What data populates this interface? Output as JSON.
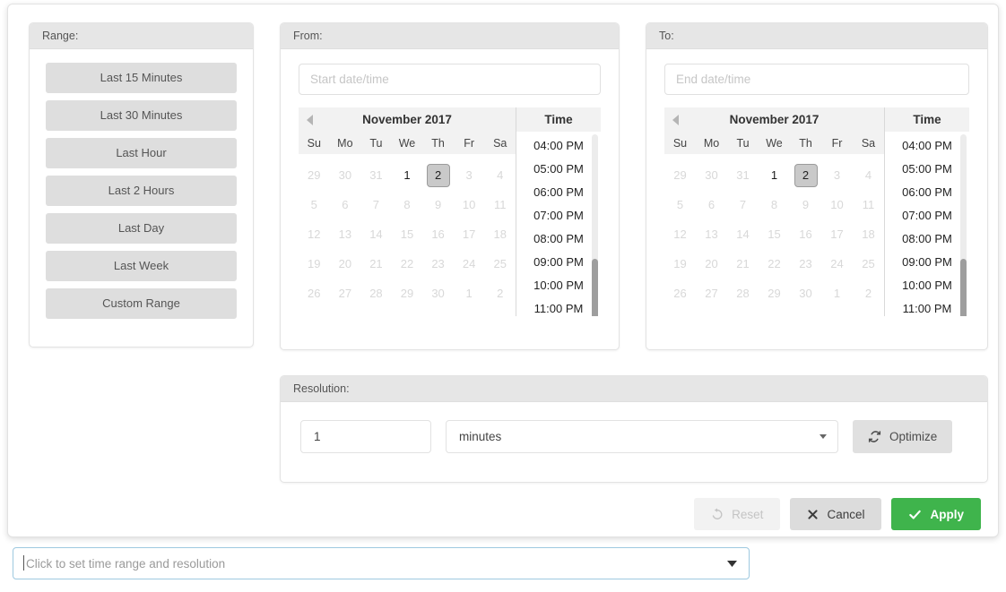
{
  "popover": {
    "range": {
      "header": "Range:",
      "buttons": [
        "Last 15 Minutes",
        "Last 30 Minutes",
        "Last Hour",
        "Last 2 Hours",
        "Last Day",
        "Last Week",
        "Custom Range"
      ]
    },
    "from": {
      "header": "From:",
      "input_value": "",
      "input_placeholder": "Start date/time",
      "calendar": {
        "prev_icon": "chevron-left-icon",
        "month_title": "November 2017",
        "weekdays": [
          "Su",
          "Mo",
          "Tu",
          "We",
          "Th",
          "Fr",
          "Sa"
        ],
        "weeks": [
          [
            {
              "d": "29",
              "state": "disabled"
            },
            {
              "d": "30",
              "state": "disabled"
            },
            {
              "d": "31",
              "state": "disabled"
            },
            {
              "d": "1",
              "state": "enabled"
            },
            {
              "d": "2",
              "state": "selected"
            },
            {
              "d": "3",
              "state": "disabled"
            },
            {
              "d": "4",
              "state": "disabled"
            }
          ],
          [
            {
              "d": "5",
              "state": "disabled"
            },
            {
              "d": "6",
              "state": "disabled"
            },
            {
              "d": "7",
              "state": "disabled"
            },
            {
              "d": "8",
              "state": "disabled"
            },
            {
              "d": "9",
              "state": "disabled"
            },
            {
              "d": "10",
              "state": "disabled"
            },
            {
              "d": "11",
              "state": "disabled"
            }
          ],
          [
            {
              "d": "12",
              "state": "disabled"
            },
            {
              "d": "13",
              "state": "disabled"
            },
            {
              "d": "14",
              "state": "disabled"
            },
            {
              "d": "15",
              "state": "disabled"
            },
            {
              "d": "16",
              "state": "disabled"
            },
            {
              "d": "17",
              "state": "disabled"
            },
            {
              "d": "18",
              "state": "disabled"
            }
          ],
          [
            {
              "d": "19",
              "state": "disabled"
            },
            {
              "d": "20",
              "state": "disabled"
            },
            {
              "d": "21",
              "state": "disabled"
            },
            {
              "d": "22",
              "state": "disabled"
            },
            {
              "d": "23",
              "state": "disabled"
            },
            {
              "d": "24",
              "state": "disabled"
            },
            {
              "d": "25",
              "state": "disabled"
            }
          ],
          [
            {
              "d": "26",
              "state": "disabled"
            },
            {
              "d": "27",
              "state": "disabled"
            },
            {
              "d": "28",
              "state": "disabled"
            },
            {
              "d": "29",
              "state": "disabled"
            },
            {
              "d": "30",
              "state": "disabled"
            },
            {
              "d": "1",
              "state": "disabled"
            },
            {
              "d": "2",
              "state": "disabled"
            }
          ]
        ]
      },
      "time": {
        "header": "Time",
        "items": [
          "04:00 PM",
          "05:00 PM",
          "06:00 PM",
          "07:00 PM",
          "08:00 PM",
          "09:00 PM",
          "10:00 PM",
          "11:00 PM"
        ]
      }
    },
    "to": {
      "header": "To:",
      "input_value": "",
      "input_placeholder": "End date/time",
      "calendar": {
        "prev_icon": "chevron-left-icon",
        "month_title": "November 2017",
        "weekdays": [
          "Su",
          "Mo",
          "Tu",
          "We",
          "Th",
          "Fr",
          "Sa"
        ],
        "weeks": [
          [
            {
              "d": "29",
              "state": "disabled"
            },
            {
              "d": "30",
              "state": "disabled"
            },
            {
              "d": "31",
              "state": "disabled"
            },
            {
              "d": "1",
              "state": "enabled"
            },
            {
              "d": "2",
              "state": "selected"
            },
            {
              "d": "3",
              "state": "disabled"
            },
            {
              "d": "4",
              "state": "disabled"
            }
          ],
          [
            {
              "d": "5",
              "state": "disabled"
            },
            {
              "d": "6",
              "state": "disabled"
            },
            {
              "d": "7",
              "state": "disabled"
            },
            {
              "d": "8",
              "state": "disabled"
            },
            {
              "d": "9",
              "state": "disabled"
            },
            {
              "d": "10",
              "state": "disabled"
            },
            {
              "d": "11",
              "state": "disabled"
            }
          ],
          [
            {
              "d": "12",
              "state": "disabled"
            },
            {
              "d": "13",
              "state": "disabled"
            },
            {
              "d": "14",
              "state": "disabled"
            },
            {
              "d": "15",
              "state": "disabled"
            },
            {
              "d": "16",
              "state": "disabled"
            },
            {
              "d": "17",
              "state": "disabled"
            },
            {
              "d": "18",
              "state": "disabled"
            }
          ],
          [
            {
              "d": "19",
              "state": "disabled"
            },
            {
              "d": "20",
              "state": "disabled"
            },
            {
              "d": "21",
              "state": "disabled"
            },
            {
              "d": "22",
              "state": "disabled"
            },
            {
              "d": "23",
              "state": "disabled"
            },
            {
              "d": "24",
              "state": "disabled"
            },
            {
              "d": "25",
              "state": "disabled"
            }
          ],
          [
            {
              "d": "26",
              "state": "disabled"
            },
            {
              "d": "27",
              "state": "disabled"
            },
            {
              "d": "28",
              "state": "disabled"
            },
            {
              "d": "29",
              "state": "disabled"
            },
            {
              "d": "30",
              "state": "disabled"
            },
            {
              "d": "1",
              "state": "disabled"
            },
            {
              "d": "2",
              "state": "disabled"
            }
          ]
        ]
      },
      "time": {
        "header": "Time",
        "items": [
          "04:00 PM",
          "05:00 PM",
          "06:00 PM",
          "07:00 PM",
          "08:00 PM",
          "09:00 PM",
          "10:00 PM",
          "11:00 PM"
        ]
      }
    },
    "resolution": {
      "header": "Resolution:",
      "amount_value": "1",
      "unit_value": "minutes",
      "unit_caret_icon": "chevron-down-icon",
      "optimize_label": "Optimize",
      "optimize_icon": "refresh-icon"
    },
    "actions": {
      "reset_label": "Reset",
      "reset_icon": "undo-icon",
      "reset_disabled": true,
      "cancel_label": "Cancel",
      "cancel_icon": "close-icon",
      "apply_label": "Apply",
      "apply_icon": "check-icon"
    }
  },
  "combo": {
    "placeholder": "Click to set time range and resolution",
    "value": "",
    "caret_icon": "chevron-down-icon"
  },
  "colors": {
    "accent_green": "#3fb44c",
    "panel_header": "#e6e6e6",
    "range_button": "#dedede",
    "selected_day": "#c9c9c9",
    "focus_border": "#9ec9e0"
  }
}
